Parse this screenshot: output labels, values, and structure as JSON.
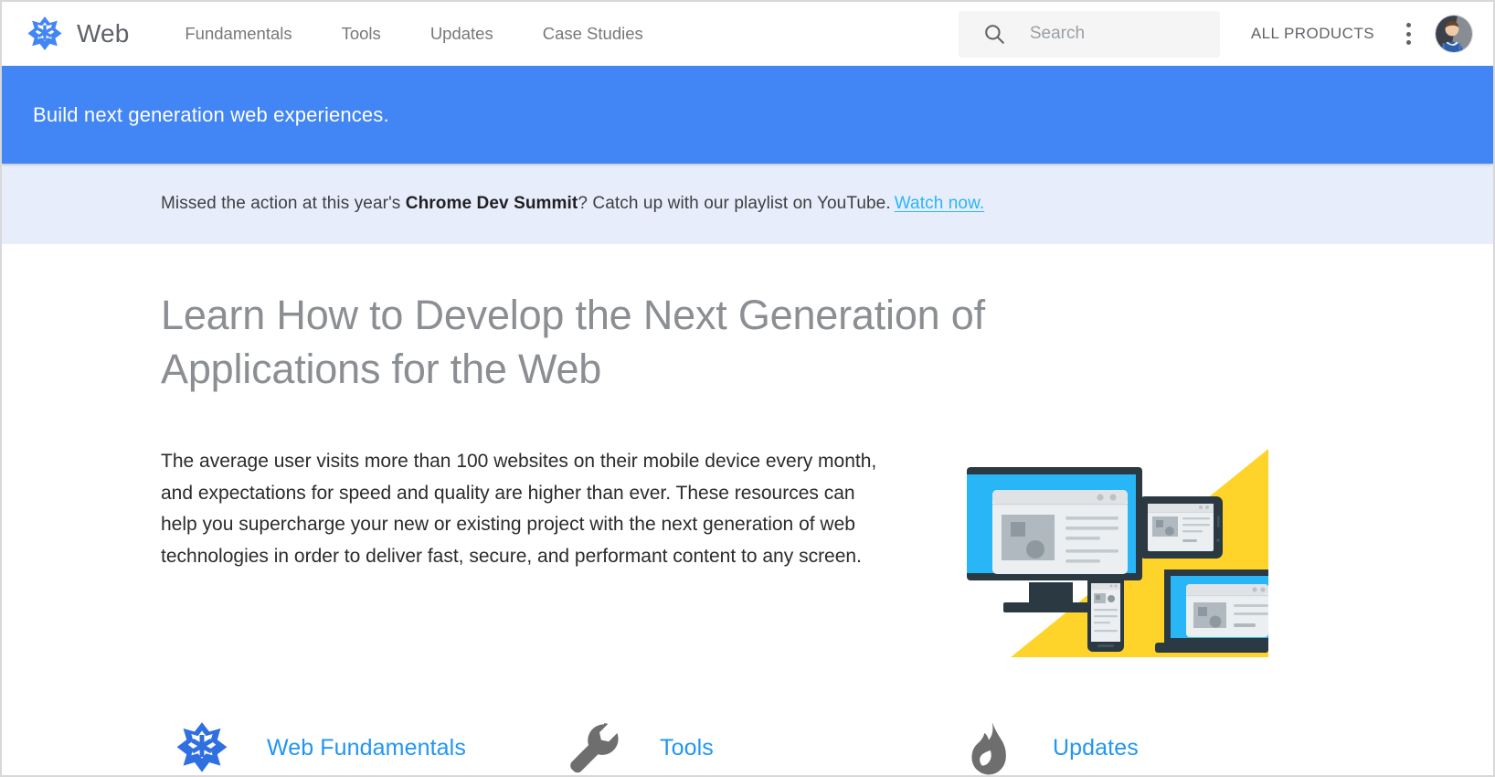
{
  "header": {
    "logo_icon": "web-asterisk-logo",
    "brand_title": "Web",
    "nav": [
      {
        "label": "Fundamentals"
      },
      {
        "label": "Tools"
      },
      {
        "label": "Updates"
      },
      {
        "label": "Case Studies"
      }
    ],
    "search": {
      "icon": "search-icon",
      "placeholder": "Search",
      "value": ""
    },
    "all_products_label": "ALL PRODUCTS",
    "overflow_icon": "kebab-menu-icon",
    "avatar_icon": "user-avatar-photo"
  },
  "hero": {
    "tagline": "Build next generation web experiences."
  },
  "notice": {
    "text_before": "Missed the action at this year's ",
    "text_bold": "Chrome Dev Summit",
    "text_after": "? Catch up with our playlist on YouTube.",
    "link_label": "Watch now."
  },
  "main": {
    "title": "Learn How to Develop the Next Generation of Applications for the Web",
    "lead": "The average user visits more than 100 websites on their mobile device every month, and expectations for speed and quality are higher than ever. These resources can help you supercharge your new or existing project with the next generation of web technologies in order to deliver fast, secure, and performant content to any screen.",
    "illustration_name": "multi-device-responsive-illustration"
  },
  "cards": [
    {
      "icon": "web-asterisk-icon",
      "label": "Web Fundamentals"
    },
    {
      "icon": "wrench-icon",
      "label": "Tools"
    },
    {
      "icon": "flame-icon",
      "label": "Updates"
    }
  ],
  "colors": {
    "brand_blue": "#4285f4",
    "link_blue": "#2196f3",
    "notice_bg": "#e8edfb",
    "notice_link": "#29b6f6",
    "title_gray": "#8b8e92",
    "icon_gray": "#757575",
    "illustration_yellow": "#fed42b",
    "illustration_blue": "#29b6f6",
    "illustration_dark": "#2b3942"
  }
}
